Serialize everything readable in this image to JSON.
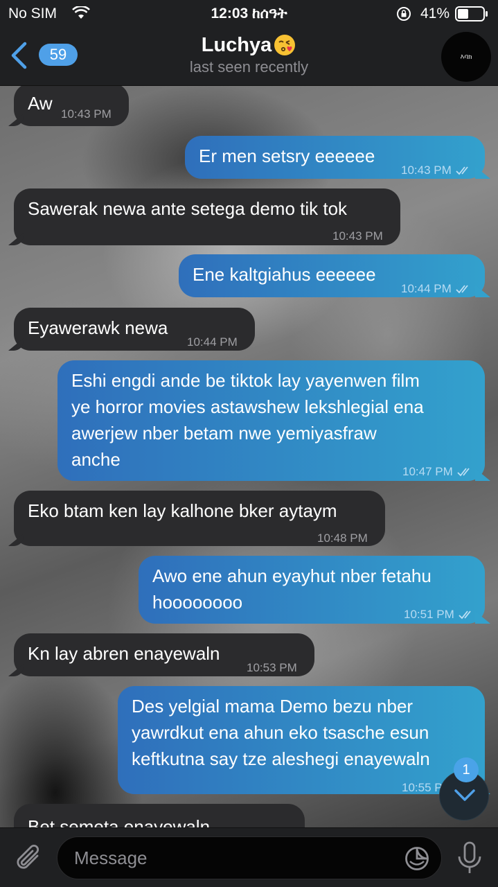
{
  "status_bar": {
    "carrier": "No SIM",
    "time": "12:03 ከሰዓት",
    "battery_pct": "41%",
    "icons": [
      "wifi-icon",
      "orientation-lock-icon",
      "battery-icon"
    ]
  },
  "header": {
    "back_badge": "59",
    "title": "Luchya",
    "title_emoji": "kissing-face-emoji",
    "subtitle": "last seen recently",
    "avatar_text": "እባክ"
  },
  "messages": [
    {
      "dir": "in",
      "lines": [
        "Aw"
      ],
      "time": "10:43 PM"
    },
    {
      "dir": "out",
      "lines": [
        "Er men setsry eeeeee"
      ],
      "time": "10:43 PM",
      "read": true
    },
    {
      "dir": "in",
      "lines": [
        "Sawerak newa ante setega demo tik tok"
      ],
      "time": "10:43 PM"
    },
    {
      "dir": "out",
      "lines": [
        "Ene kaltgiahus eeeeee"
      ],
      "time": "10:44 PM",
      "read": true
    },
    {
      "dir": "in",
      "lines": [
        "Eyawerawk newa"
      ],
      "time": "10:44 PM"
    },
    {
      "dir": "out",
      "lines": [
        "Eshi engdi ande be tiktok lay yayenwen film",
        "ye horror movies astawshew lekshlegial ena",
        "awerjew nber betam nwe yemiyasfraw",
        "anche"
      ],
      "time": "10:47 PM",
      "read": true
    },
    {
      "dir": "in",
      "lines": [
        "Eko btam ken lay kalhone bker aytaym"
      ],
      "time": "10:48 PM"
    },
    {
      "dir": "out",
      "lines": [
        "Awo ene ahun eyayhut nber fetahu",
        "hoooooooo"
      ],
      "time": "10:51 PM",
      "read": true
    },
    {
      "dir": "in",
      "lines": [
        "Kn lay abren enayewaln"
      ],
      "time": "10:53 PM"
    },
    {
      "dir": "out",
      "lines": [
        "Des yelgial mama Demo bezu nber",
        "yawrdkut ena ahun eko tsasche esun",
        "keftkutna say tze aleshegi enayewaln"
      ],
      "time": "10:55 PM",
      "read": true
    },
    {
      "dir": "in",
      "lines": [
        "Bet semeta enayewaln"
      ],
      "time": ""
    }
  ],
  "scroll_down": {
    "unread": "1"
  },
  "composer": {
    "placeholder": "Message"
  },
  "colors": {
    "accent": "#4fa0e8",
    "bubble_in": "#2b2b2d",
    "bubble_out_start": "#2f6fbb",
    "bubble_out_end": "#33a1cd",
    "bar_bg": "#1f2022"
  }
}
